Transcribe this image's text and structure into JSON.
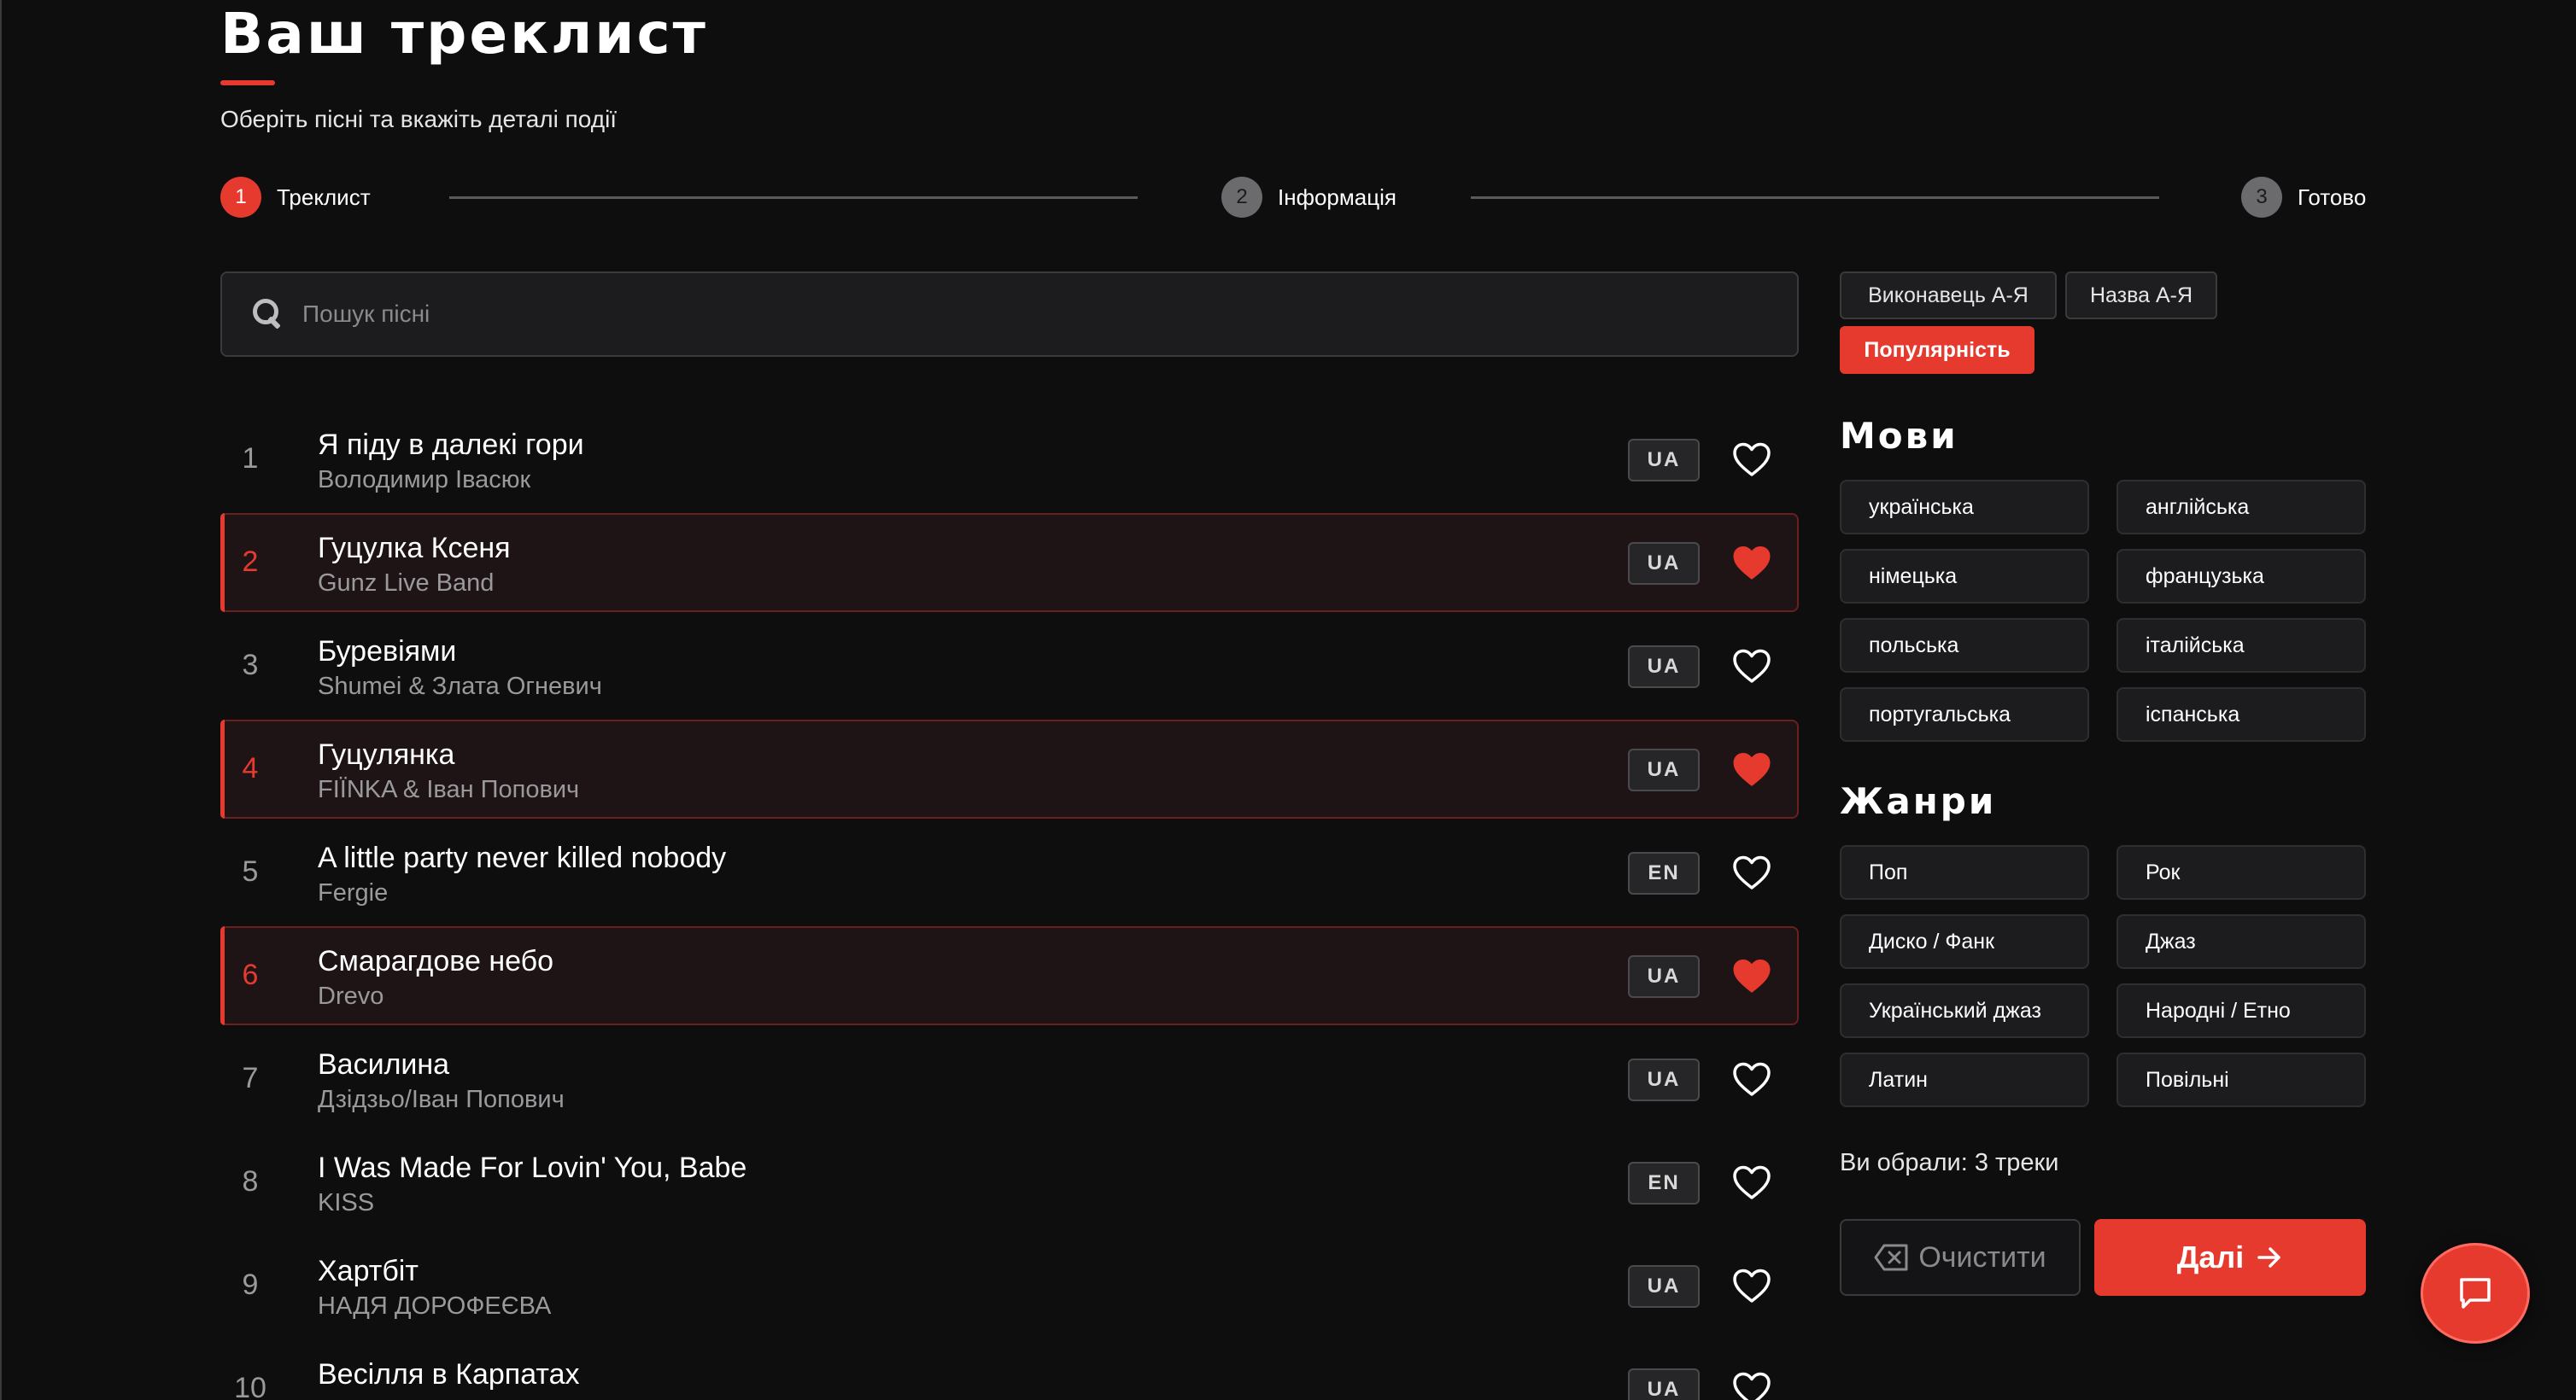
{
  "header": {
    "title": "Ваш треклист",
    "subtitle": "Оберіть пісні та вкажіть деталі події"
  },
  "steps": [
    {
      "number": "1",
      "label": "Треклист",
      "active": true
    },
    {
      "number": "2",
      "label": "Інформація",
      "active": false
    },
    {
      "number": "3",
      "label": "Готово",
      "active": false
    }
  ],
  "search": {
    "placeholder": "Пошук пісні",
    "value": ""
  },
  "tracks": [
    {
      "num": "1",
      "title": "Я піду в далекі гори",
      "artist": "Володимир Івасюк",
      "lang": "UA",
      "liked": false
    },
    {
      "num": "2",
      "title": "Гуцулка Ксеня",
      "artist": "Gunz Live Band",
      "lang": "UA",
      "liked": true
    },
    {
      "num": "3",
      "title": "Буревіями",
      "artist": "Shumei & Злата Огневич",
      "lang": "UA",
      "liked": false
    },
    {
      "num": "4",
      "title": "Гуцулянка",
      "artist": "FIЇNKA & Іван Попович",
      "lang": "UA",
      "liked": true
    },
    {
      "num": "5",
      "title": "A little party never killed nobody",
      "artist": "Fergie",
      "lang": "EN",
      "liked": false
    },
    {
      "num": "6",
      "title": "Смарагдове небо",
      "artist": "Drevo",
      "lang": "UA",
      "liked": true
    },
    {
      "num": "7",
      "title": "Василина",
      "artist": "Дзідзьо/Іван Попович",
      "lang": "UA",
      "liked": false
    },
    {
      "num": "8",
      "title": "I Was Made For Lovin' You, Babe",
      "artist": "KISS",
      "lang": "EN",
      "liked": false
    },
    {
      "num": "9",
      "title": "Хартбіт",
      "artist": "НАДЯ ДОРОФЕЄВА",
      "lang": "UA",
      "liked": false
    },
    {
      "num": "10",
      "title": "Весілля в Карпатах",
      "artist": "",
      "lang": "UA",
      "liked": false
    }
  ],
  "sort": {
    "options": [
      {
        "label": "Виконавець А-Я",
        "active": false
      },
      {
        "label": "Назва А-Я",
        "active": false
      },
      {
        "label": "Популярність",
        "active": true
      }
    ]
  },
  "languages": {
    "title": "Мови",
    "items": [
      "українська",
      "англійська",
      "німецька",
      "французька",
      "польська",
      "італійська",
      "португальська",
      "іспанська"
    ]
  },
  "genres": {
    "title": "Жанри",
    "items": [
      "Поп",
      "Рок",
      "Диско / Фанк",
      "Джаз",
      "Український джаз",
      "Народні / Етно",
      "Латин",
      "Повільні"
    ]
  },
  "summary": {
    "selected_text": "Ви обрали: 3 треки",
    "clear_label": "Очистити",
    "next_label": "Далі"
  },
  "colors": {
    "accent": "#e63a2e",
    "background": "#0e0e0f",
    "muted_text": "#9a9a9c"
  },
  "icons": {
    "search": "search-icon",
    "heart": "heart-icon",
    "clear": "backspace-icon",
    "next": "arrow-right-icon",
    "chat": "chat-icon"
  }
}
